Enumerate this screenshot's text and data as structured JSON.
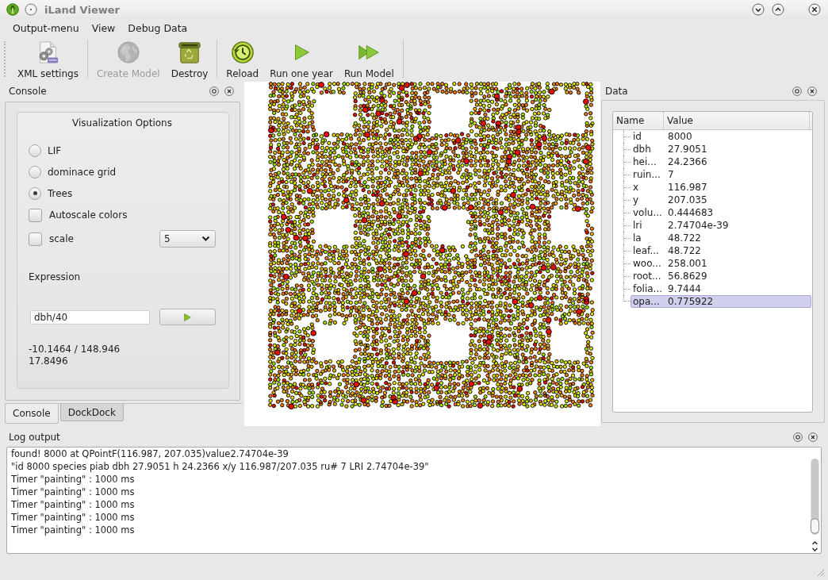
{
  "window": {
    "title": "iLand Viewer"
  },
  "menu_bar": [
    "Output-menu",
    "View",
    "Debug Data"
  ],
  "toolbar": {
    "groups": [
      [
        {
          "kind": "xml",
          "label": "XML settings",
          "disabled": false
        }
      ],
      [
        {
          "kind": "globe",
          "label": "Create Model",
          "disabled": true
        },
        {
          "kind": "trash",
          "label": "Destroy",
          "disabled": false
        }
      ],
      [
        {
          "kind": "reload",
          "label": "Reload",
          "disabled": false
        },
        {
          "kind": "play",
          "label": "Run one year",
          "disabled": false
        },
        {
          "kind": "fast_forward",
          "label": "Run Model",
          "disabled": false
        }
      ]
    ]
  },
  "console_dock": {
    "title": "Console",
    "group_title": "Visualization Options",
    "options": [
      {
        "kind": "radio",
        "label": "LIF",
        "selected": false
      },
      {
        "kind": "radio",
        "label": "dominace grid",
        "selected": false
      },
      {
        "kind": "radio",
        "label": "Trees",
        "selected": true
      },
      {
        "kind": "checkbox",
        "label": "Autoscale colors",
        "checked": false
      },
      {
        "kind": "checkbox",
        "label": "scale",
        "checked": false,
        "dropdown": "5"
      }
    ],
    "expression_label": "Expression",
    "expression": {
      "value": "dbh/40"
    },
    "result_lines": [
      "-10.1464 / 148.946",
      "17.8496"
    ],
    "tabs": [
      {
        "label": "Console",
        "selected": true
      },
      {
        "label": "DockDock",
        "selected": false
      }
    ]
  },
  "data_dock": {
    "title": "Data",
    "columns": [
      "Name",
      "Value"
    ],
    "rows": [
      {
        "name": "id",
        "value": "8000",
        "selected": false
      },
      {
        "name": "dbh",
        "value": "27.9051",
        "selected": false
      },
      {
        "name": "hei...",
        "value": "24.2366",
        "selected": false
      },
      {
        "name": "ruin...",
        "value": "7",
        "selected": false
      },
      {
        "name": "x",
        "value": "116.987",
        "selected": false
      },
      {
        "name": "y",
        "value": "207.035",
        "selected": false
      },
      {
        "name": "volu...",
        "value": "0.444683",
        "selected": false
      },
      {
        "name": "lri",
        "value": "2.74704e-39",
        "selected": false
      },
      {
        "name": "la",
        "value": "48.722",
        "selected": false
      },
      {
        "name": "leaf...",
        "value": "48.722",
        "selected": false
      },
      {
        "name": "woo...",
        "value": "258.001",
        "selected": false
      },
      {
        "name": "root...",
        "value": "56.8629",
        "selected": false
      },
      {
        "name": "folia...",
        "value": "9.7444",
        "selected": false
      },
      {
        "name": "opa...",
        "value": "0.775922",
        "selected": true
      }
    ]
  },
  "log_dock": {
    "title": "Log output",
    "lines": [
      "found! 8000 at QPointF(116.987, 207.035)value2.74704e-39",
      "\"id 8000 species piab dbh 27.9051 h 24.2366 x/y 116.987/207.035 ru# 7 LRI 2.74704e-39\"",
      "Timer \"painting\" : 1000 ms",
      "Timer \"painting\" : 1000 ms",
      "Timer \"painting\" : 1000 ms",
      "Timer \"painting\" : 1000 ms",
      "Timer \"painting\" : 1000 ms"
    ]
  }
}
